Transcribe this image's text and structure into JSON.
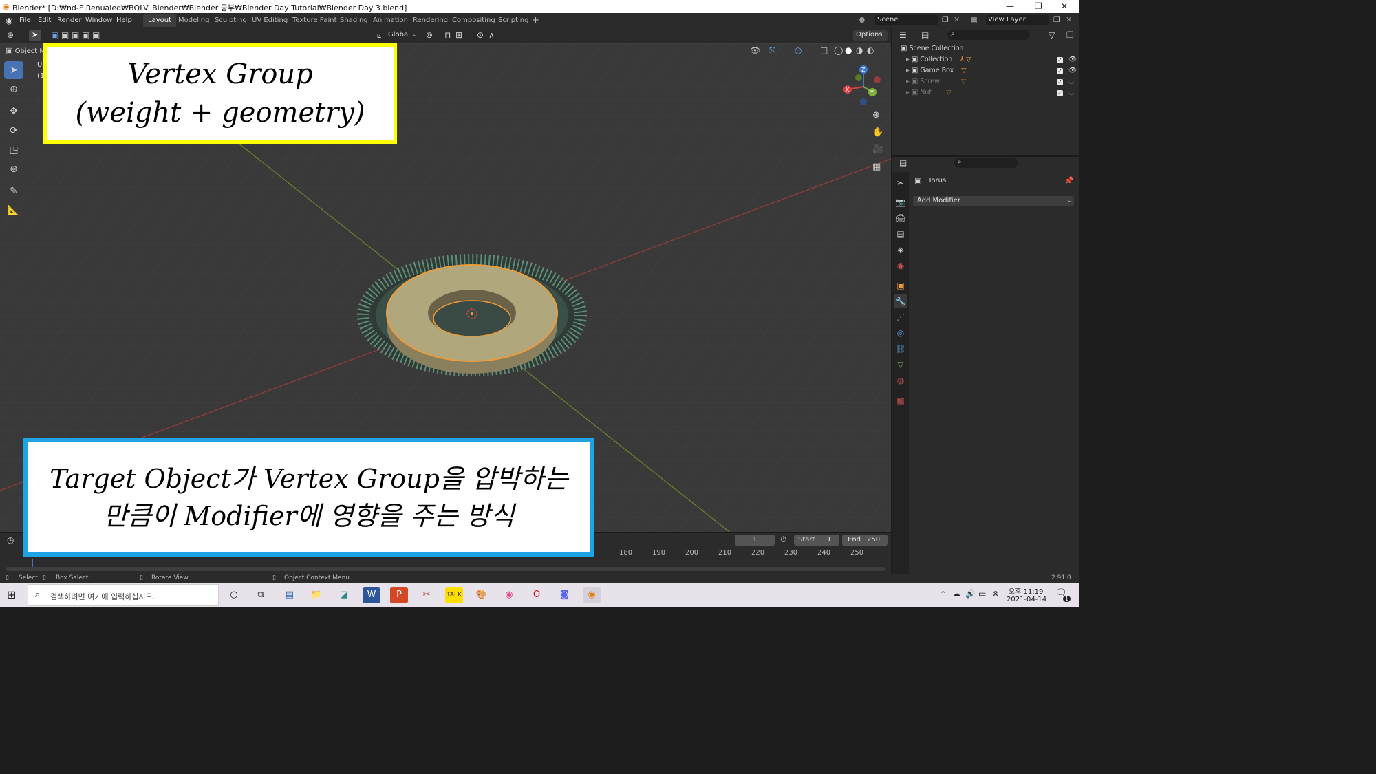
{
  "window": {
    "title": "Blender* [D:₩nd-F Renualed₩BQLV_Blender₩Blender 공부₩Blender Day Tutorial₩Blender Day 3.blend]",
    "minimize": "—",
    "restore": "❐",
    "close": "✕"
  },
  "menu": {
    "items": [
      "File",
      "Edit",
      "Render",
      "Window",
      "Help"
    ]
  },
  "workspaces": {
    "tabs": [
      "Layout",
      "Modeling",
      "Sculpting",
      "UV Editing",
      "Texture Paint",
      "Shading",
      "Animation",
      "Rendering",
      "Compositing",
      "Scripting"
    ],
    "active": "Layout",
    "add": "+"
  },
  "top_right": {
    "scene": "Scene",
    "view_layer": "View Layer"
  },
  "viewport_header": {
    "mode": "Object M",
    "transform_orientation": "Global",
    "options": "Options"
  },
  "viewport": {
    "info_line1": "Us",
    "info_line2": "(1",
    "gizmo_axes": [
      "Z",
      "X",
      "Y"
    ]
  },
  "annotations": {
    "box1_line1": "Vertex Group",
    "box1_line2": "(weight + geometry)",
    "box2_line1": "Target Object가 Vertex Group을 압박하는",
    "box2_line2": "만큼이 Modifier에 영향을 주는 방식"
  },
  "timeline": {
    "current_frame": "1",
    "start_label": "Start",
    "start_value": "1",
    "end_label": "End",
    "end_value": "250",
    "ticks": [
      "180",
      "190",
      "200",
      "210",
      "220",
      "230",
      "240",
      "250"
    ]
  },
  "statusbar": {
    "select": "Select",
    "box_select": "Box Select",
    "rotate_view": "Rotate View",
    "context_menu": "Object Context Menu",
    "version": "2.91.0"
  },
  "outliner": {
    "root": "Scene Collection",
    "items": [
      {
        "label": "Collection",
        "dim": false
      },
      {
        "label": "Game Box",
        "dim": false
      },
      {
        "label": "Screw",
        "dim": true
      },
      {
        "label": "Nut",
        "dim": true
      }
    ]
  },
  "properties": {
    "object_name": "Torus",
    "add_modifier": "Add Modifier"
  },
  "taskbar": {
    "search_placeholder": "검색하려면 여기에 입력하십시오.",
    "time": "오후 11:19",
    "date": "2021-04-14",
    "notification_count": "1"
  },
  "colors": {
    "accent_blue": "#4772b3",
    "yellow_border": "#ffff00",
    "blue_border": "#1ea4e3",
    "selection_orange": "#f29c38"
  }
}
